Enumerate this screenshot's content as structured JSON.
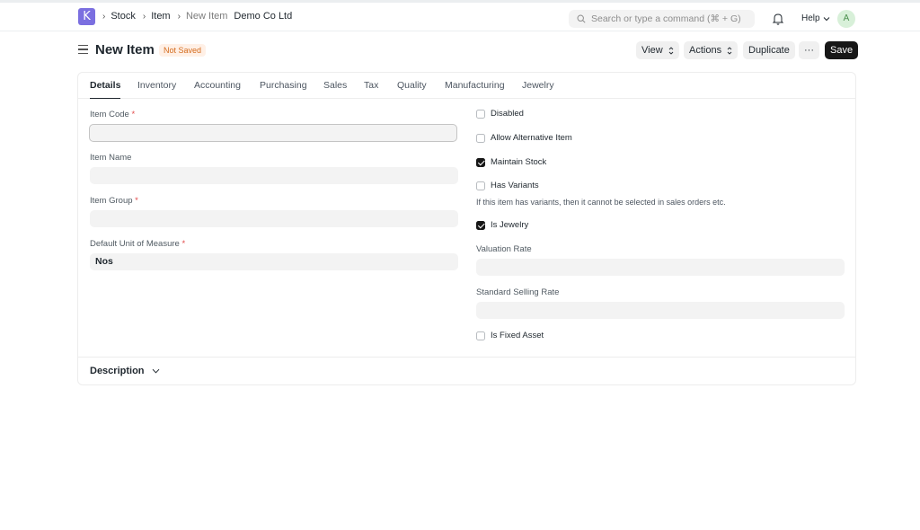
{
  "nav": {
    "logo_letter": "K",
    "breadcrumbs": [
      "Stock",
      "Item",
      "New Item"
    ],
    "company": "Demo Co Ltd",
    "search_placeholder": "Search or type a command (⌘ + G)",
    "help_label": "Help",
    "avatar_letter": "A"
  },
  "header": {
    "title": "New Item",
    "status_badge": "Not Saved",
    "view_label": "View",
    "actions_label": "Actions",
    "duplicate_label": "Duplicate",
    "more_label": "···",
    "save_label": "Save"
  },
  "tabs": [
    "Details",
    "Inventory",
    "Accounting",
    "Purchasing",
    "Sales",
    "Tax",
    "Quality",
    "Manufacturing",
    "Jewelry"
  ],
  "left_fields": {
    "item_code": {
      "label": "Item Code",
      "required": "*",
      "value": ""
    },
    "item_name": {
      "label": "Item Name",
      "value": ""
    },
    "item_group": {
      "label": "Item Group",
      "required": "*",
      "value": ""
    },
    "uom": {
      "label": "Default Unit of Measure",
      "required": "*",
      "value": "Nos"
    }
  },
  "right_fields": {
    "disabled": {
      "label": "Disabled",
      "checked": false
    },
    "allow_alternative": {
      "label": "Allow Alternative Item",
      "checked": false
    },
    "maintain_stock": {
      "label": "Maintain Stock",
      "checked": true
    },
    "has_variants": {
      "label": "Has Variants",
      "checked": false
    },
    "has_variants_help": "If this item has variants, then it cannot be selected in sales orders etc.",
    "is_jewelry": {
      "label": "Is Jewelry",
      "checked": true
    },
    "valuation_rate": {
      "label": "Valuation Rate",
      "value": ""
    },
    "standard_selling_rate": {
      "label": "Standard Selling Rate",
      "value": ""
    },
    "is_fixed_asset": {
      "label": "Is Fixed Asset",
      "checked": false
    }
  },
  "sections": {
    "description_label": "Description"
  }
}
